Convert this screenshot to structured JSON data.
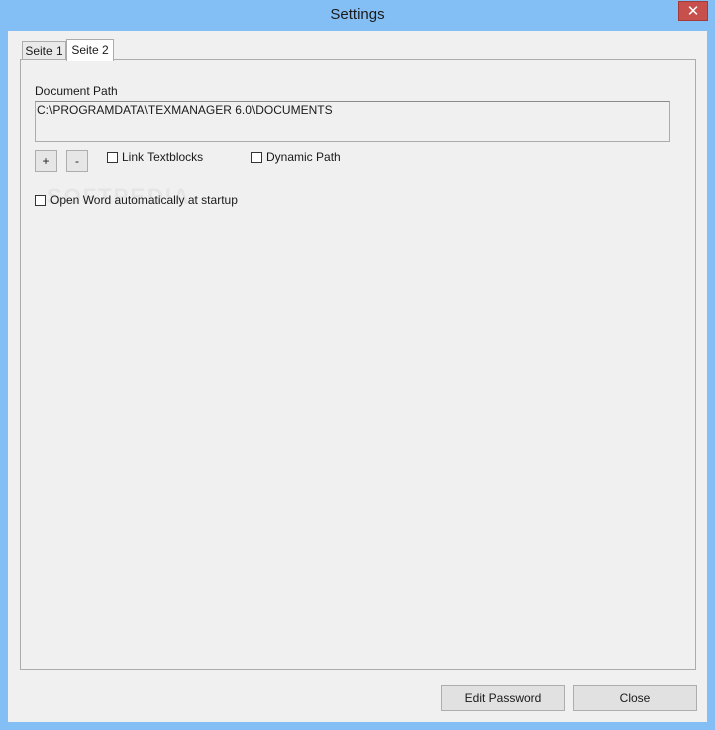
{
  "window": {
    "title": "Settings",
    "close_glyph": "✕"
  },
  "tabs": [
    {
      "label": "Seite 1"
    },
    {
      "label": "Seite 2"
    }
  ],
  "active_tab": "Seite 2",
  "document_path": {
    "label": "Document Path",
    "value": "C:\\PROGRAMDATA\\TEXMANAGER 6.0\\DOCUMENTS"
  },
  "path_buttons": {
    "add_label": "+",
    "remove_label": "-"
  },
  "checkboxes": {
    "link_textblocks": {
      "label": "Link Textblocks",
      "checked": false
    },
    "dynamic_path": {
      "label": "Dynamic Path",
      "checked": false
    },
    "open_word_startup": {
      "label": "Open Word automatically at startup",
      "checked": false
    }
  },
  "watermark": "SOFTPEDIA",
  "footer": {
    "edit_password_label": "Edit Password",
    "close_label": "Close"
  }
}
